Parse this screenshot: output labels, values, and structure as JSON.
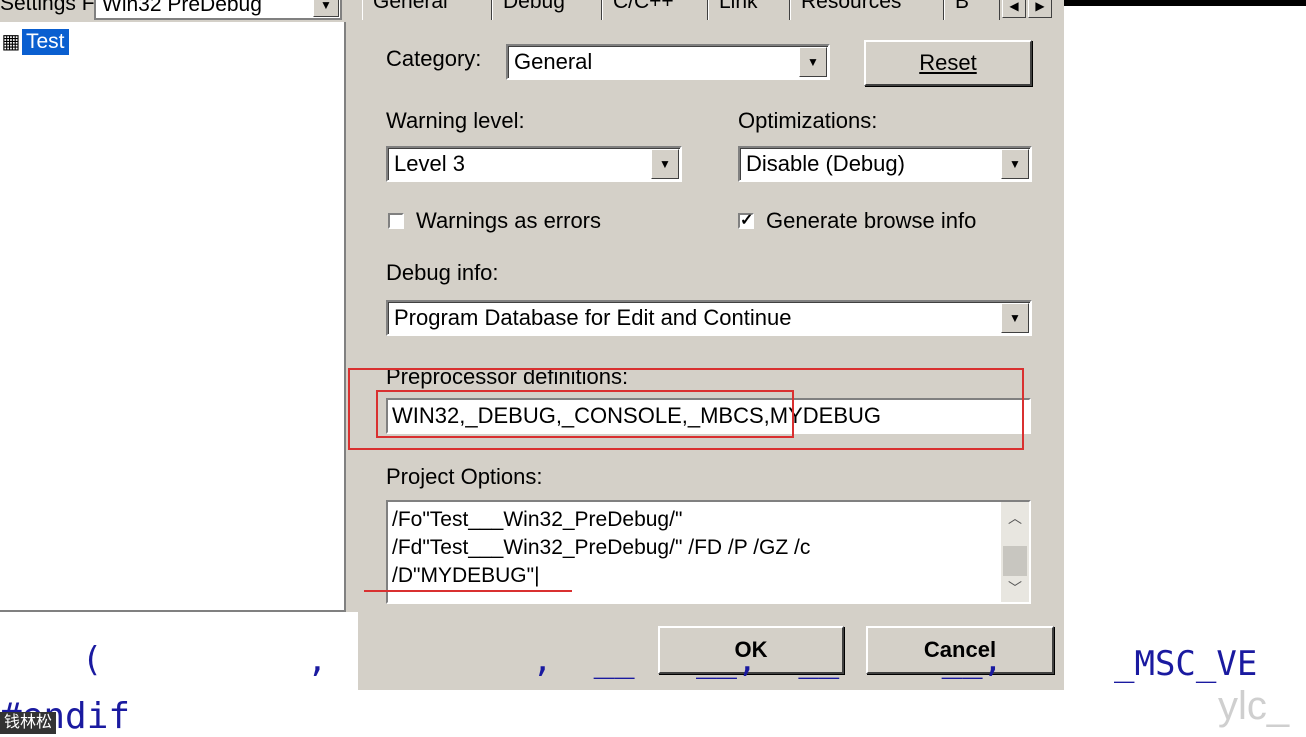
{
  "left": {
    "settings_label": "Settings For:",
    "settings_value": "Win32 PreDebug",
    "tree_label": "Test"
  },
  "tabs": [
    "General",
    "Debug",
    "C/C++",
    "Link",
    "Resources",
    "B"
  ],
  "category": {
    "label": "Category:",
    "value": "General"
  },
  "reset_button": "Reset",
  "warning_level": {
    "label": "Warning level:",
    "value": "Level 3"
  },
  "optimizations": {
    "label": "Optimizations:",
    "value": "Disable (Debug)"
  },
  "warnings_as_errors": {
    "label": "Warnings as errors",
    "checked": false
  },
  "generate_browse_info": {
    "label": "Generate browse info",
    "checked": true
  },
  "debug_info": {
    "label": "Debug info:",
    "value": "Program Database for Edit and Continue"
  },
  "preprocessor": {
    "label": "Preprocessor definitions:",
    "value": "WIN32,_DEBUG,_CONSOLE,_MBCS,MYDEBUG"
  },
  "project_options": {
    "label": "Project Options:",
    "lines": [
      "/Fo\"Test___Win32_PreDebug/\"",
      "/Fd\"Test___Win32_PreDebug/\" /FD /P /GZ /c",
      "/D\"MYDEBUG\"|"
    ]
  },
  "ok_button": "OK",
  "cancel_button": "Cancel",
  "code": {
    "line1": "    (          ,          ,  __   __,  __     __,",
    "msc": "_MSC_VE",
    "line2": "#endif"
  },
  "watermark": "钱林松",
  "brand": "ylc_",
  "colors": {
    "highlight": "#0a5fd0",
    "annotation_red": "#d93030",
    "code_blue": "#1a1aa0"
  }
}
